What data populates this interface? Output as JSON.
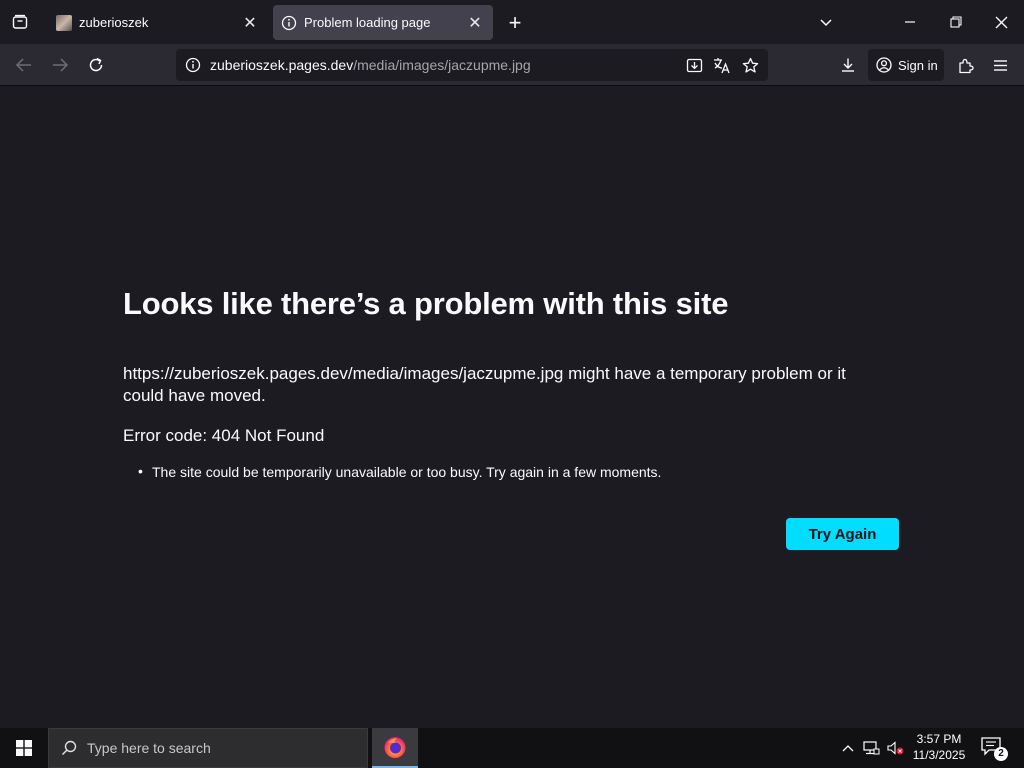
{
  "browser": {
    "tabs": [
      {
        "title": "zuberioszek",
        "active": false
      },
      {
        "title": "Problem loading page",
        "active": true
      }
    ],
    "url": {
      "host": "zuberioszek.pages.dev",
      "path": "/media/images/jaczupme.jpg"
    },
    "signin_label": "Sign in",
    "icons": {
      "tab_list": "tab-list-icon",
      "new_tab": "plus-icon",
      "all_tabs": "chevron-down-icon",
      "minimize": "minimize-icon",
      "restore": "restore-icon",
      "close": "close-icon",
      "back": "back-arrow-icon",
      "forward": "forward-arrow-icon",
      "reload": "reload-icon",
      "site_info": "info-icon",
      "install": "install-icon",
      "translate": "translate-icon",
      "bookmark": "star-icon",
      "downloads": "download-icon",
      "account": "account-icon",
      "extensions": "extensions-icon",
      "menu": "hamburger-menu-icon"
    }
  },
  "error_page": {
    "title": "Looks like there’s a problem with this site",
    "description": "https://zuberioszek.pages.dev/media/images/jaczupme.jpg might have a temporary problem or it could have moved.",
    "error_code": "Error code: 404 Not Found",
    "suggestions": [
      "The site could be temporarily unavailable or too busy. Try again in a few moments."
    ],
    "try_again_label": "Try Again",
    "accent_color": "#00ddff"
  },
  "taskbar": {
    "search_placeholder": "Type here to search",
    "time": "3:57 PM",
    "date": "11/3/2025",
    "notification_count": "2"
  }
}
